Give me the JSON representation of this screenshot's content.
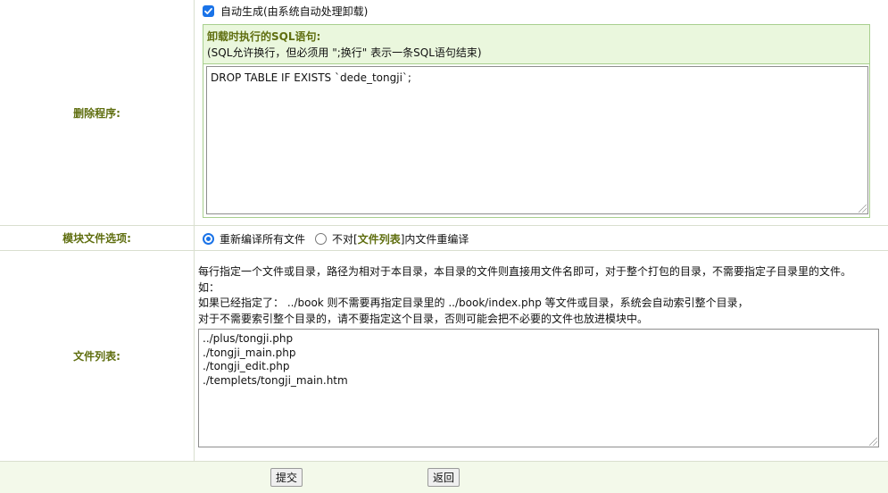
{
  "delete_program": {
    "label": "删除程序:",
    "auto_generate_label": "自动生成(由系统自动处理卸载)",
    "auto_generate_checked": true,
    "sql_title": "卸载时执行的SQL语句:",
    "sql_hint": "(SQL允许换行，但必须用 \";换行\" 表示一条SQL语句结束)",
    "sql_value": "DROP TABLE IF EXISTS `dede_tongji`;"
  },
  "module_options": {
    "label": "模块文件选项:",
    "option_recompile": "重新编译所有文件",
    "option_recompile_selected": true,
    "option_prefix": "不对[",
    "option_link": "文件列表",
    "option_suffix": "]内文件重编译",
    "option_other_selected": false
  },
  "file_list": {
    "label": "文件列表:",
    "desc_lines": [
      "每行指定一个文件或目录，路径为相对于本目录，本目录的文件则直接用文件名即可，对于整个打包的目录，不需要指定子目录里的文件。",
      "如：",
      "如果已经指定了： ../book 则不需要再指定目录里的 ../book/index.php 等文件或目录，系统会自动索引整个目录，",
      "对于不需要索引整个目录的，请不要指定这个目录，否则可能会把不必要的文件也放进模块中。"
    ],
    "files": [
      "../plus/tongji.php",
      "./tongji_main.php",
      "./tongji_edit.php",
      "./templets/tongji_main.htm"
    ]
  },
  "footer": {
    "submit_label": "提交",
    "back_label": "返回"
  },
  "colors": {
    "label_green": "#5f6e0f",
    "panel_bg": "#eaf7dd",
    "panel_border": "#a8cf8e",
    "accent_blue": "#1a73e8"
  }
}
